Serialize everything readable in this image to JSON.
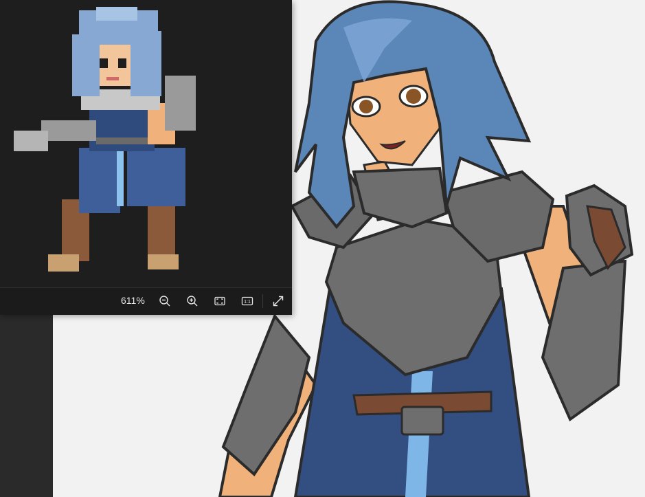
{
  "viewer": {
    "zoom_label": "611%",
    "controls": [
      {
        "name": "zoom-out-icon"
      },
      {
        "name": "zoom-in-icon"
      },
      {
        "name": "fit-to-window-icon"
      },
      {
        "name": "actual-size-icon",
        "label": "1:1"
      },
      {
        "name": "expand-icon"
      }
    ]
  },
  "colors": {
    "hair": "#5b86b8",
    "armor": "#6a6a6a",
    "skin": "#f0b27a",
    "outfit": "#334f82",
    "dark_panel": "#1e1e1e"
  }
}
